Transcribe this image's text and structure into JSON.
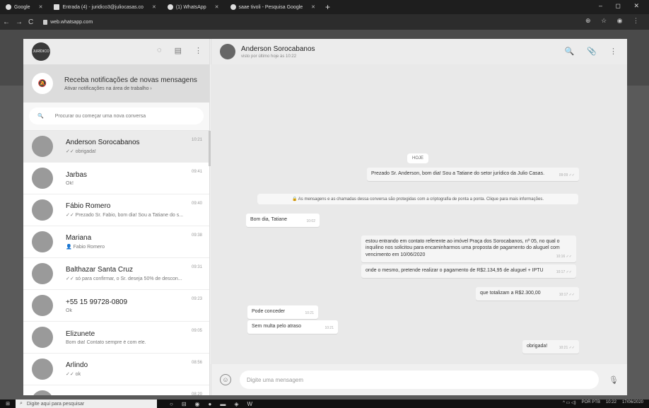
{
  "browser": {
    "tabs": [
      {
        "label": "Google"
      },
      {
        "label": "Entrada (4) - juridico3@juliocasas.co"
      },
      {
        "label": "(1) WhatsApp"
      },
      {
        "label": "saae tivoli - Pesquisa Google"
      }
    ],
    "url": "web.whatsapp.com"
  },
  "sidebar": {
    "me_avatar_text": "JURÍDICO",
    "notification": {
      "title": "Receba notificações de novas mensagens",
      "subtitle": "Ativar notificações na área de trabalho ›"
    },
    "search_placeholder": "Procurar ou começar uma nova conversa",
    "chats": [
      {
        "name": "Anderson Sorocabanos",
        "message": "✓✓ obrigada!",
        "time": "10:21"
      },
      {
        "name": "Jarbas",
        "message": "Ok!",
        "time": "09:41"
      },
      {
        "name": "Fábio Romero",
        "message": "✓✓ Prezado Sr. Fabio, bom dia! Sou a Tatiane do s...",
        "time": "09:40"
      },
      {
        "name": "Mariana",
        "message": "👤 Fabio Romero",
        "time": "09:38"
      },
      {
        "name": "Balthazar Santa Cruz",
        "message": "✓✓ só para confirmar, o Sr. deseja 50% de descon...",
        "time": "09:31"
      },
      {
        "name": "+55 15 99728-0809",
        "message": "Ok",
        "time": "09:23"
      },
      {
        "name": "Elizunete",
        "message": "Bom dia! Contato sempre é com ele.",
        "time": "09:05"
      },
      {
        "name": "Arlindo",
        "message": "✓✓ ok",
        "time": "08:56"
      },
      {
        "name": "Rubens BREDA",
        "message": "",
        "time": "08:20"
      }
    ]
  },
  "conversation": {
    "contact_name": "Anderson Sorocabanos",
    "last_seen": "visto por último hoje às 10:22",
    "day_label": "HOJE",
    "messages": [
      {
        "text": "Prezado Sr. Anderson, bom dia! Sou a Tatiane do setor jurídico da Julio Casas.",
        "time": "09:09 ✓✓"
      },
      {
        "text": "🔒 As mensagens e as chamadas dessa conversa são protegidas com a criptografia de ponta a ponta. Clique para mais informações."
      },
      {
        "text": "Bom dia, Tatiane",
        "time": "10:02"
      },
      {
        "text": "estou entrando em contato referente ao imóvel Praça dos Sorocabanos, nº 05, no qual o inquilino nos solicitou para encaminharmos uma proposta de pagamento do aluguel com vencimento em 10/06/2020",
        "time": "10:16 ✓✓"
      },
      {
        "text": "onde o mesmo, pretende realizar o pagamento de R$2.134,95 de aluguel + IPTU",
        "time": "10:17 ✓✓"
      },
      {
        "text": "que totalizam a R$2.300,00",
        "time": "10:17 ✓✓"
      },
      {
        "text": "Pode conceder",
        "time": "10:21"
      },
      {
        "text": "Sem multa pelo atraso",
        "time": "10:21"
      },
      {
        "text": "obrigada!",
        "time": "10:21 ✓✓"
      }
    ],
    "input_placeholder": "Digite uma mensagem"
  },
  "taskbar": {
    "search_text": "Digite aqui para pesquisar",
    "lang": "POR PTB",
    "time": "10:22",
    "date": "17/06/2020"
  }
}
